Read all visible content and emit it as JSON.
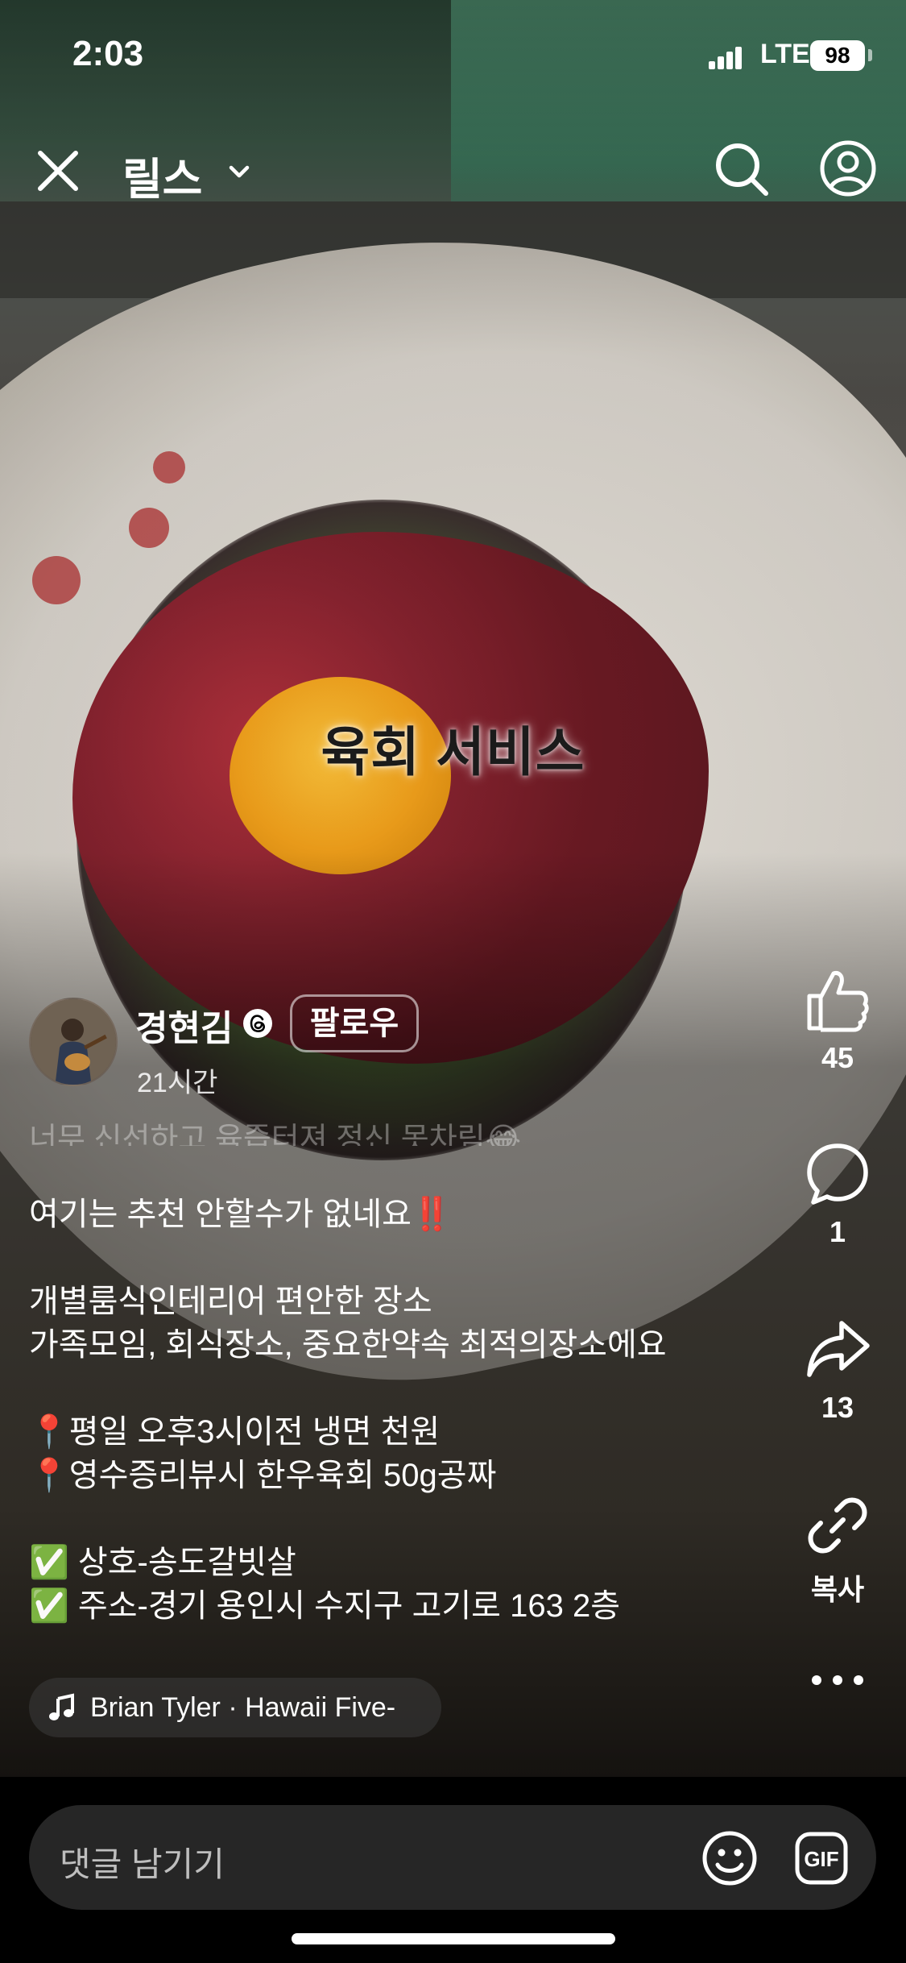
{
  "status_bar": {
    "time": "2:03",
    "network": "LTE",
    "battery": "98"
  },
  "nav": {
    "title": "릴스"
  },
  "video": {
    "overlay_text": "육회 서비스"
  },
  "actions": {
    "like": {
      "icon": "thumbs-up-icon",
      "count": "45"
    },
    "comment": {
      "icon": "comment-icon",
      "count": "1"
    },
    "share": {
      "icon": "share-icon",
      "count": "13"
    },
    "copy": {
      "icon": "link-icon",
      "label": "복사"
    },
    "more": {
      "icon": "more-icon"
    }
  },
  "author": {
    "name": "경현김",
    "follow_label": "팔로우",
    "time_ago": "21시간"
  },
  "caption": {
    "faded_line": "너무 신선하고 육즙터져 정신 못차림😂",
    "lines": [
      "여기는 추천 안할수가 없네요‼️",
      "",
      "개별룸식인테리어 편안한 장소",
      "가족모임, 회식장소, 중요한약속 최적의장소에요",
      "",
      "📍평일 오후3시이전 냉면 천원",
      "📍영수증리뷰시 한우육회 50g공짜",
      "",
      "✅ 상호-송도갈빗살",
      "✅ 주소-경기 용인시 수지구 고기로 163 2층"
    ]
  },
  "music": {
    "text": "Brian Tyler · Hawaii Five-"
  },
  "comment_bar": {
    "placeholder": "댓글 남기기"
  },
  "colors": {
    "background": "#000000",
    "input_bg": "#262626",
    "text": "#ffffff"
  }
}
